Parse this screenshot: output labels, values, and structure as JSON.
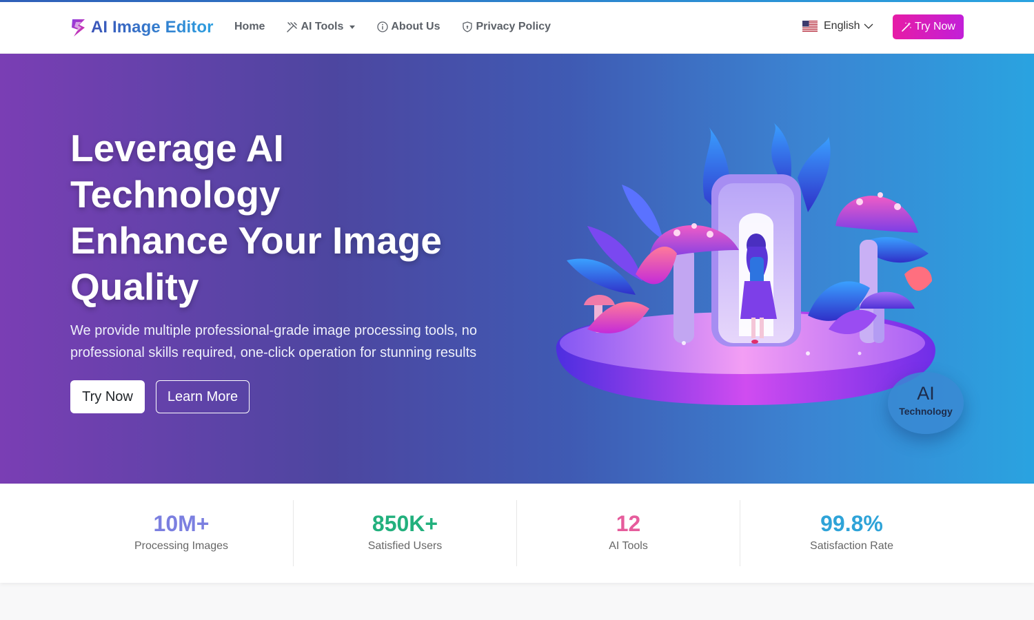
{
  "brand": {
    "name": "AI Image Editor",
    "logo_icon": "lightning-s-logo-icon"
  },
  "nav": {
    "items": [
      {
        "label": "Home",
        "icon": ""
      },
      {
        "label": "AI Tools",
        "icon": "tools-icon"
      },
      {
        "label": "About Us",
        "icon": "info-circle-icon"
      },
      {
        "label": "Privacy Policy",
        "icon": "shield-icon"
      }
    ],
    "language": "English",
    "language_flag": "us-flag-icon",
    "cta_label": "Try Now"
  },
  "hero": {
    "title_lines": [
      "Leverage AI",
      "Technology",
      "Enhance Your Image",
      "Quality"
    ],
    "subtitle": "We provide multiple professional-grade image processing tools, no professional skills required, one-click operation for stunning results",
    "primary_button": "Try Now",
    "secondary_button": "Learn More",
    "badge": {
      "big": "AI",
      "small": "Technology"
    }
  },
  "stats": [
    {
      "value": "10M+",
      "label": "Processing Images",
      "color": "#7b7fe0"
    },
    {
      "value": "850K+",
      "label": "Satisfied Users",
      "color": "#22b07d"
    },
    {
      "value": "12",
      "label": "AI Tools",
      "color": "#e65c9c"
    },
    {
      "value": "99.8%",
      "label": "Satisfaction Rate",
      "color": "#2ea3d8"
    }
  ],
  "colors": {
    "brand_gradient_start": "#3b54b8",
    "brand_gradient_end": "#2d9fe0",
    "cta_magenta": "#e61ca6",
    "hero_start": "#7a3eb4",
    "hero_end": "#2aa3e0"
  }
}
